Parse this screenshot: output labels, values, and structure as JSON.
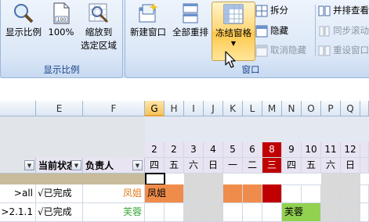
{
  "ribbon": {
    "groups": {
      "display_ratio": {
        "title": "显示比例",
        "buttons": [
          "显示比例",
          "100%",
          "缩放到\n选定区域"
        ]
      },
      "window": {
        "title": "窗口",
        "new_window": "新建窗口",
        "arrange_all": "全部重排",
        "freeze_panes": "冻结窗格",
        "split": "拆分",
        "hide": "隐藏",
        "unhide": "取消隐藏",
        "view_side_by_side": "并排查看",
        "sync_scroll": "同步滚动",
        "reset_position": "重设窗口"
      }
    }
  },
  "sheet": {
    "columns": [
      "E",
      "F",
      "G",
      "H",
      "I",
      "J",
      "K",
      "L",
      "M",
      "N",
      "O",
      "P",
      "Q"
    ],
    "selected_column": "G",
    "day_numbers": [
      "2",
      "3",
      "4",
      "5",
      "6",
      "7",
      "8",
      "9",
      "10",
      "11",
      "12"
    ],
    "weekdays": [
      "四",
      "五",
      "六",
      "日",
      "一",
      "二",
      "三",
      "四",
      "五",
      "六",
      "日"
    ],
    "highlight_day": "8",
    "headers": {
      "status": "当前状态",
      "owner": "负责人"
    },
    "rows": [
      {
        "id": ">all",
        "status": "√已完成",
        "owner": "凤姐",
        "bar_label": "凤姐"
      },
      {
        "id": ">2.1.1",
        "status": "√已完成",
        "owner": "芙蓉",
        "bar_label": "芙蓉"
      }
    ]
  },
  "colors": {
    "highlight": "#c00000",
    "orange": "#f08c4b",
    "green": "#92d050",
    "owner1": "#e07b1f",
    "owner2": "#3aa63a"
  }
}
